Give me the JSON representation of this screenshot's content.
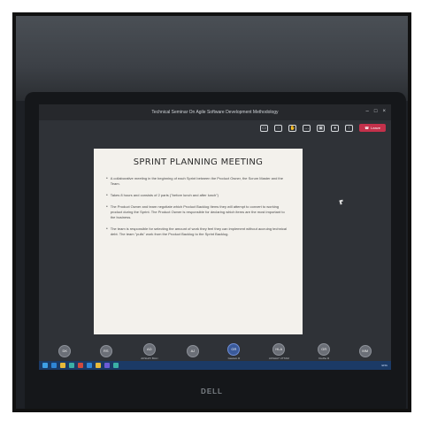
{
  "window": {
    "title": "Technical Seminar On Agile Software Development Methodology",
    "controls": [
      "–",
      "□",
      "×"
    ]
  },
  "toolbar": {
    "icons": [
      "chat-icon",
      "people-icon",
      "raise-hand-icon",
      "more-icon",
      "camera-icon",
      "mic-icon",
      "share-icon"
    ],
    "leave_label": "Leave"
  },
  "slide": {
    "title": "SPRINT PLANNING MEETING",
    "bullets": [
      "A collaborative meeting in the beginning of each Sprint between the Product Owner, the Scrum Master and the Team.",
      "Takes 8 hours and consists of 2 parts (\"before lunch and after lunch\")",
      "The Product Owner and team negotiate which Product Backlog Items they will attempt to convert to working product during the Sprint. The Product Owner is responsible for declaring which items are the most important to the business.",
      "The team is responsible for selecting the amount of work they feel they can implement without accruing technical debt. The team \"pulls\" work from the Product Backlog to the Sprint Backlog."
    ]
  },
  "participants": [
    {
      "initials": "DK",
      "name": ""
    },
    {
      "initials": "RS",
      "name": ""
    },
    {
      "initials": "AD",
      "name": "AKSHAY BALI"
    },
    {
      "initials": "AJ",
      "name": ""
    },
    {
      "initials": "GR",
      "name": "Gautam R"
    },
    {
      "initials": "HLA",
      "name": "AKSHAY UTTAM"
    },
    {
      "initials": "GR",
      "name": "Dudhe R"
    },
    {
      "initials": "MM",
      "name": ""
    }
  ],
  "taskbar": {
    "tray_text": "ENG"
  },
  "device": {
    "brand": "DELL"
  }
}
